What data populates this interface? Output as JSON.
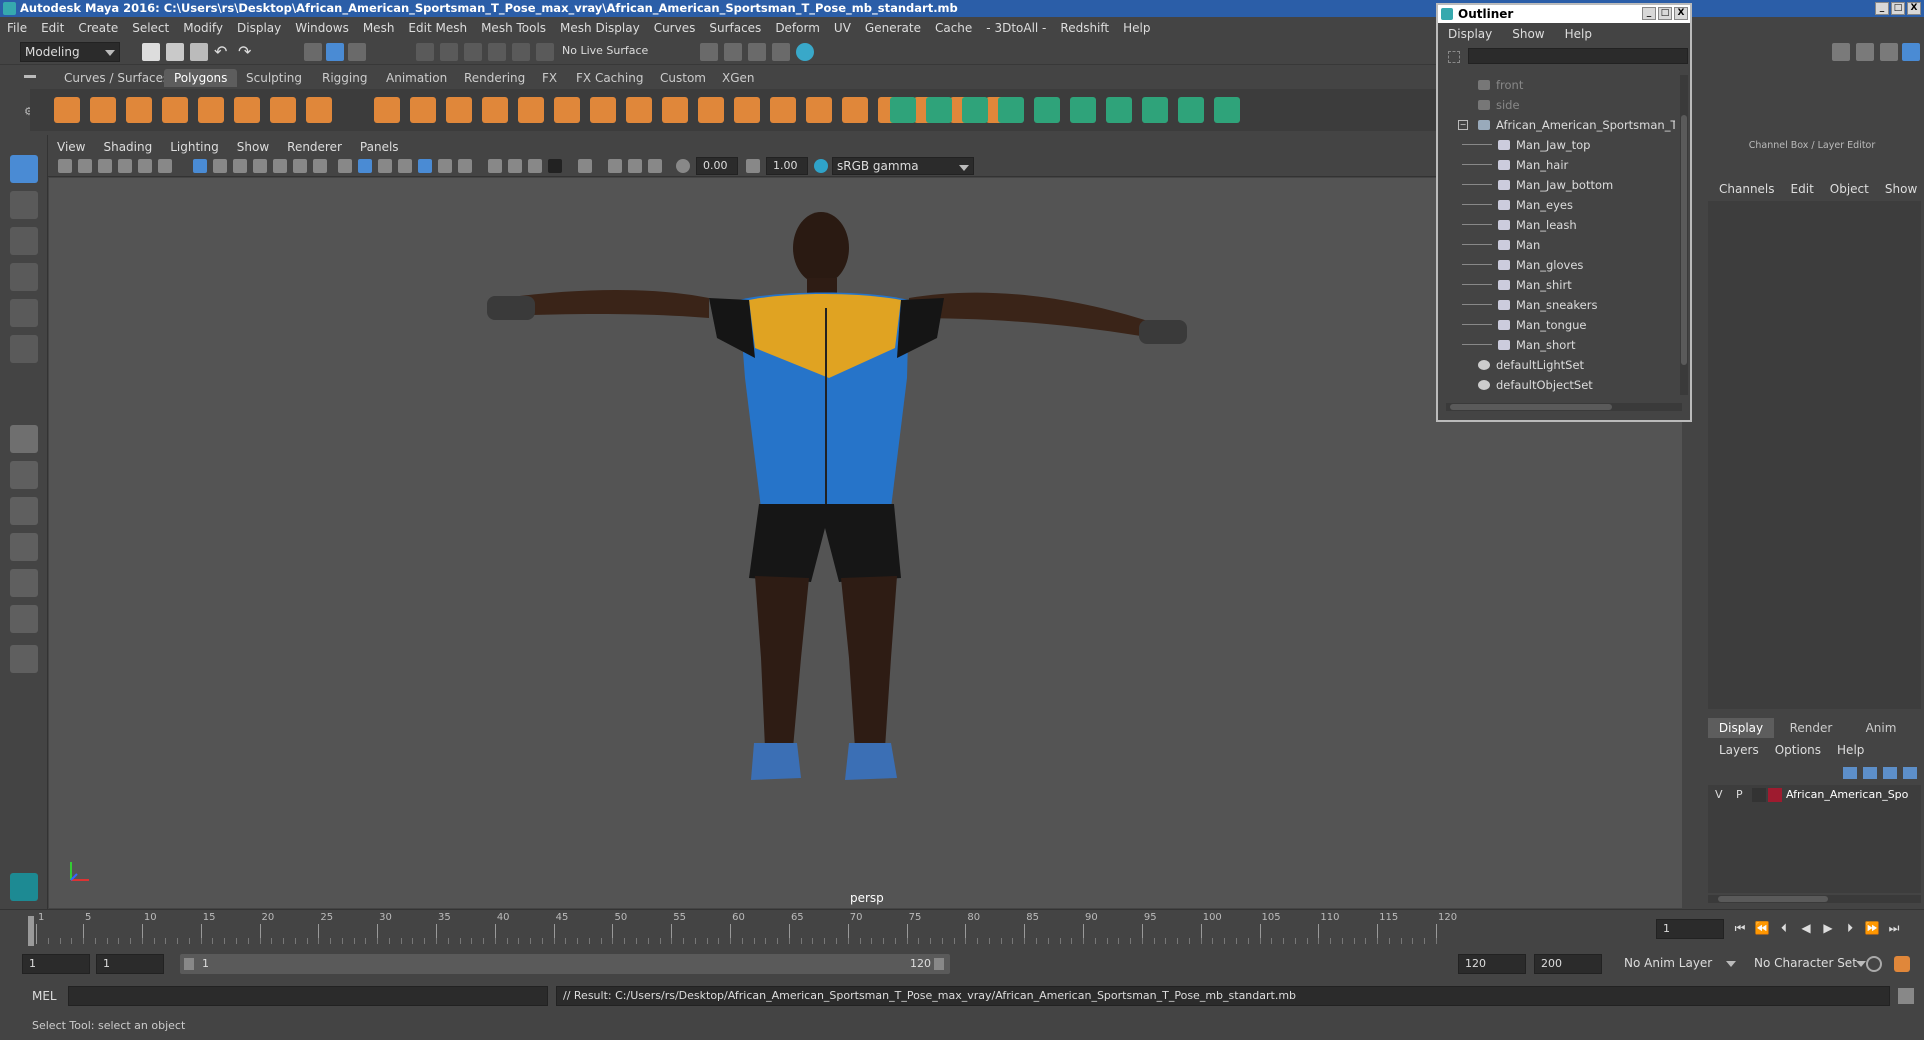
{
  "window": {
    "title": "Autodesk Maya 2016: C:\\Users\\rs\\Desktop\\African_American_Sportsman_T_Pose_max_vray\\African_American_Sportsman_T_Pose_mb_standart.mb",
    "minimize": "_",
    "maximize": "□",
    "close": "X"
  },
  "menu": [
    "File",
    "Edit",
    "Create",
    "Select",
    "Modify",
    "Display",
    "Windows",
    "Mesh",
    "Edit Mesh",
    "Mesh Tools",
    "Mesh Display",
    "Curves",
    "Surfaces",
    "Deform",
    "UV",
    "Generate",
    "Cache",
    "- 3DtoAll -",
    "Redshift",
    "Help"
  ],
  "status": {
    "mode": "Modeling",
    "live_surface": "No Live Surface"
  },
  "shelf_tabs": [
    "Curves / Surfaces",
    "Polygons",
    "Sculpting",
    "Rigging",
    "Animation",
    "Rendering",
    "FX",
    "FX Caching",
    "Custom",
    "XGen"
  ],
  "shelf_active_tab": "Polygons",
  "viewport": {
    "menu": [
      "View",
      "Shading",
      "Lighting",
      "Show",
      "Renderer",
      "Panels"
    ],
    "exposure": "0.00",
    "gamma": "1.00",
    "color_space": "sRGB gamma",
    "camera": "persp"
  },
  "outliner": {
    "title": "Outliner",
    "menu": [
      "Display",
      "Show",
      "Help"
    ],
    "items": [
      {
        "label": "front",
        "kind": "camera",
        "indent": 0,
        "dim": true
      },
      {
        "label": "side",
        "kind": "camera",
        "indent": 0,
        "dim": true
      },
      {
        "label": "African_American_Sportsman_T_P",
        "kind": "group",
        "indent": 0,
        "dim": false
      },
      {
        "label": "Man_Jaw_top",
        "kind": "mesh",
        "indent": 1,
        "dim": false
      },
      {
        "label": "Man_hair",
        "kind": "mesh",
        "indent": 1,
        "dim": false
      },
      {
        "label": "Man_Jaw_bottom",
        "kind": "mesh",
        "indent": 1,
        "dim": false
      },
      {
        "label": "Man_eyes",
        "kind": "mesh",
        "indent": 1,
        "dim": false
      },
      {
        "label": "Man_leash",
        "kind": "mesh",
        "indent": 1,
        "dim": false
      },
      {
        "label": "Man",
        "kind": "mesh",
        "indent": 1,
        "dim": false
      },
      {
        "label": "Man_gloves",
        "kind": "mesh",
        "indent": 1,
        "dim": false
      },
      {
        "label": "Man_shirt",
        "kind": "mesh",
        "indent": 1,
        "dim": false
      },
      {
        "label": "Man_sneakers",
        "kind": "mesh",
        "indent": 1,
        "dim": false
      },
      {
        "label": "Man_tongue",
        "kind": "mesh",
        "indent": 1,
        "dim": false
      },
      {
        "label": "Man_short",
        "kind": "mesh",
        "indent": 1,
        "dim": false
      },
      {
        "label": "defaultLightSet",
        "kind": "set",
        "indent": 0,
        "dim": false
      },
      {
        "label": "defaultObjectSet",
        "kind": "set",
        "indent": 0,
        "dim": false
      }
    ]
  },
  "channel_box": {
    "title": "Channel Box / Layer Editor",
    "menu": [
      "Channels",
      "Edit",
      "Object",
      "Show"
    ],
    "layer_tabs": [
      "Display",
      "Render",
      "Anim"
    ],
    "layer_active_tab": "Display",
    "layer_menu": [
      "Layers",
      "Options",
      "Help"
    ],
    "layer": {
      "v": "V",
      "p": "P",
      "name": "African_American_Spo",
      "color": "#9e1b2f"
    }
  },
  "timeline": {
    "ticks": [
      "1",
      "5",
      "10",
      "15",
      "20",
      "25",
      "30",
      "35",
      "40",
      "45",
      "50",
      "55",
      "60",
      "65",
      "70",
      "75",
      "80",
      "85",
      "90",
      "95",
      "100",
      "105",
      "110",
      "115",
      "120"
    ],
    "current_frame": "1",
    "current_frame_field": "1"
  },
  "range": {
    "start": "1",
    "start_playback": "1",
    "slider_start": "1",
    "slider_end": "120",
    "end_playback": "120",
    "end": "200",
    "anim_layer": "No Anim Layer",
    "character": "No Character Set"
  },
  "command": {
    "lang": "MEL",
    "result": "// Result: C:/Users/rs/Desktop/African_American_Sportsman_T_Pose_max_vray/African_American_Sportsman_T_Pose_mb_standart.mb"
  },
  "help_line": "Select Tool: select an object",
  "colors": {
    "title_bar": "#2b5ea8",
    "shelf_orange": "#e0873a",
    "shelf_teal": "#2fa37a",
    "accent_blue": "#4a8bd4"
  }
}
